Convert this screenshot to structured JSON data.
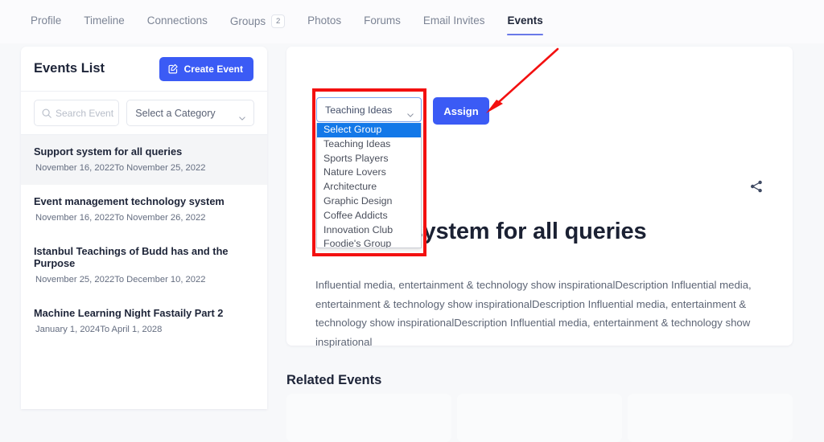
{
  "tabs": [
    {
      "label": "Profile",
      "active": false,
      "badge": null
    },
    {
      "label": "Timeline",
      "active": false,
      "badge": null
    },
    {
      "label": "Connections",
      "active": false,
      "badge": null
    },
    {
      "label": "Groups",
      "active": false,
      "badge": "2"
    },
    {
      "label": "Photos",
      "active": false,
      "badge": null
    },
    {
      "label": "Forums",
      "active": false,
      "badge": null
    },
    {
      "label": "Email Invites",
      "active": false,
      "badge": null
    },
    {
      "label": "Events",
      "active": true,
      "badge": null
    }
  ],
  "sidebar": {
    "title": "Events List",
    "create_button_label": "Create Event",
    "search": {
      "placeholder": "Search Event",
      "value": ""
    },
    "category_select": {
      "selected": "Select a Category"
    },
    "events": [
      {
        "name": "Support system for all queries",
        "dates": "November 16, 2022To November 25, 2022",
        "selected": true
      },
      {
        "name": "Event management technology system",
        "dates": "November 16, 2022To November 26, 2022",
        "selected": false
      },
      {
        "name": "Istanbul Teachings of Budd has and the Purpose",
        "dates": "November 25, 2022To December 10, 2022",
        "selected": false
      },
      {
        "name": "Machine Learning Night Fastaily Part 2",
        "dates": "January 1, 2024To April 1, 2028",
        "selected": false
      }
    ]
  },
  "main": {
    "group_select": {
      "selected": "Teaching Ideas",
      "options": [
        "Select Group",
        "Teaching Ideas",
        "Sports Players",
        "Nature Lovers",
        "Architecture",
        "Graphic Design",
        "Coffee Addicts",
        "Innovation Club",
        "Foodie's Group"
      ],
      "highlighted_option": "Select Group",
      "open": true
    },
    "assign_button_label": "Assign",
    "event_title": "Support system for all queries",
    "event_description": "Influential media, entertainment & technology show inspirationalDescription Influential media, entertainment & technology show inspirationalDescription Influential media, entertainment & technology show inspirationalDescription Influential media, entertainment & technology show inspirational",
    "related_events_title": "Related Events",
    "related_cards": [
      "",
      "",
      ""
    ]
  },
  "colors": {
    "primary": "#3b5bf5",
    "tab_active_underline": "#6a79e8",
    "annotation_red": "#f31010",
    "option_highlight": "#1378e8",
    "page_bg": "#f7f8fa"
  },
  "icons": {
    "create_event": "edit-square-icon",
    "search": "search-icon",
    "chevron": "chevron-down-icon",
    "share": "share-icon"
  }
}
